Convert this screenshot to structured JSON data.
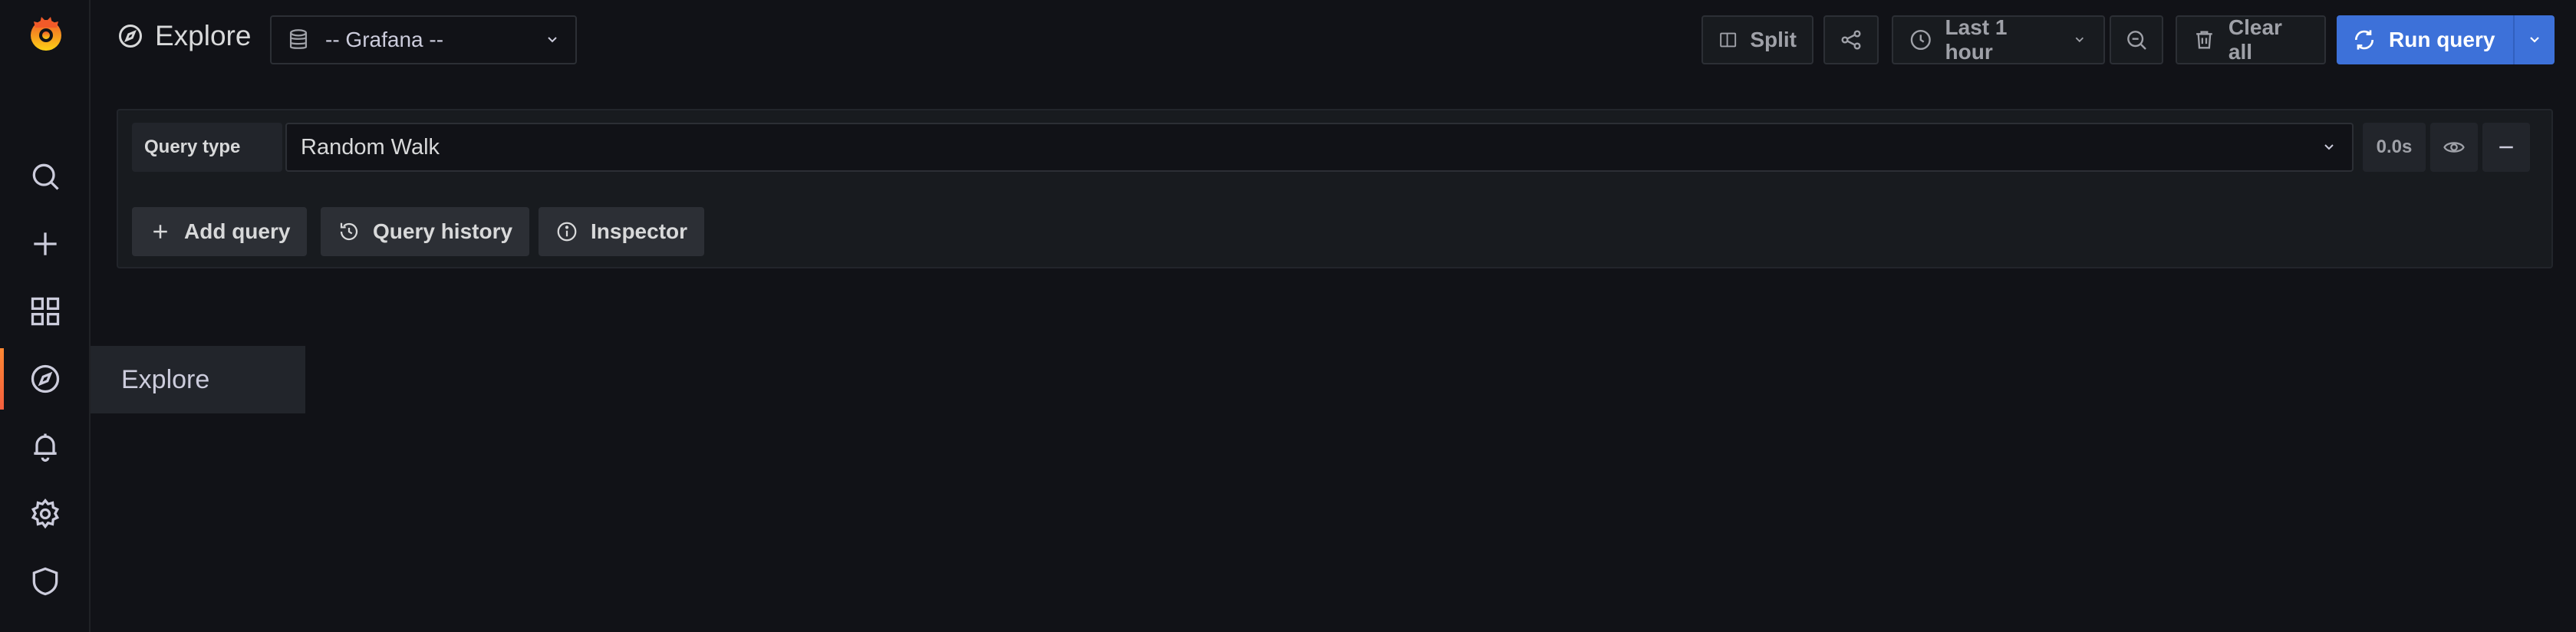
{
  "header": {
    "title": "Explore",
    "datasource": "-- Grafana --"
  },
  "toolbar": {
    "split_label": "Split",
    "time_range": "Last 1 hour",
    "clear_label": "Clear all",
    "run_label": "Run query"
  },
  "sidebar": {
    "flyout_label": "Explore",
    "items": [
      "search-icon",
      "plus-icon",
      "apps-icon",
      "compass-icon",
      "bell-icon",
      "gear-icon",
      "shield-icon"
    ]
  },
  "query": {
    "type_label": "Query type",
    "type_value": "Random Walk",
    "duration": "0.0s",
    "add_label": "Add query",
    "history_label": "Query history",
    "inspector_label": "Inspector"
  },
  "colors": {
    "accent": "#3d71d9",
    "background": "#111217",
    "logo": "#f55f3e"
  }
}
